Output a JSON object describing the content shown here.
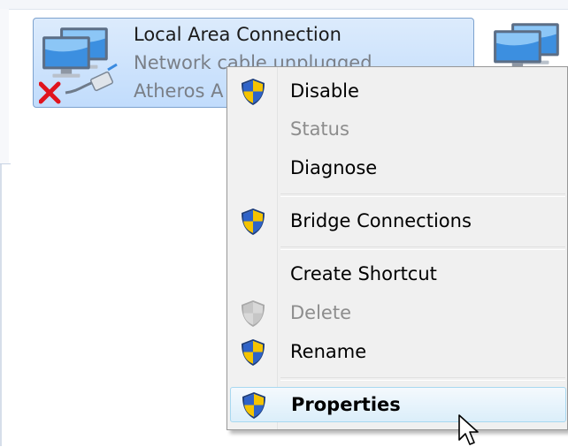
{
  "adapter": {
    "name": "Local Area Connection",
    "status": "Network cable unplugged",
    "device": "Atheros A"
  },
  "context_menu": {
    "items": [
      {
        "label": "Disable",
        "icon": "uac-shield-icon",
        "enabled": true
      },
      {
        "label": "Status",
        "icon": null,
        "enabled": false
      },
      {
        "label": "Diagnose",
        "icon": null,
        "enabled": true
      },
      {
        "label": "Bridge Connections",
        "icon": "uac-shield-icon",
        "enabled": true
      },
      {
        "label": "Create Shortcut",
        "icon": null,
        "enabled": true
      },
      {
        "label": "Delete",
        "icon": "uac-shield-icon",
        "enabled": false
      },
      {
        "label": "Rename",
        "icon": "uac-shield-icon",
        "enabled": true
      },
      {
        "label": "Properties",
        "icon": "uac-shield-icon",
        "enabled": true,
        "default": true,
        "hovered": true
      }
    ]
  },
  "colors": {
    "selection_fill": "#c1dcfc",
    "selection_border": "#7da2ce",
    "menu_background": "#f0f0f0",
    "disabled_text": "#8d8d8d",
    "shield_blue": "#2f63c8",
    "shield_yellow": "#f5c400",
    "error_x": "#e0141e"
  }
}
